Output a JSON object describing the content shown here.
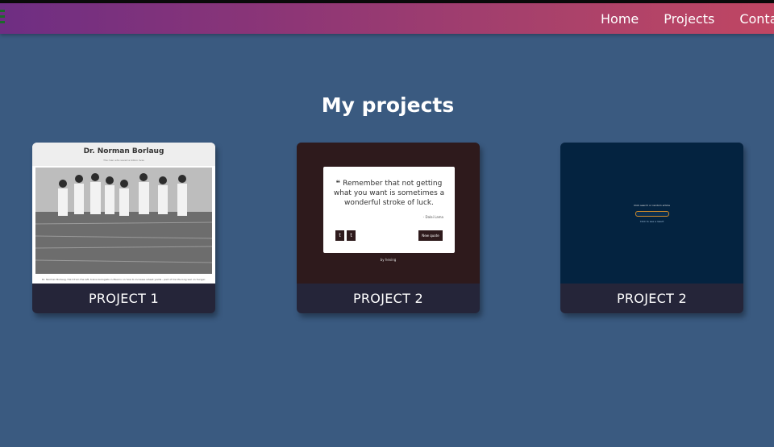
{
  "nav": {
    "links": [
      "Home",
      "Projects",
      "Contact"
    ]
  },
  "page": {
    "title": "My projects"
  },
  "projects": [
    {
      "label": "PROJECT 1",
      "thumb_title": "Dr. Norman Borlaug",
      "thumb_subtitle": "The man who saved a billion lives",
      "thumb_caption": "Dr. Norman Borlaug, third from the left, trains biologists in Mexico on how to increase wheat yields - part of his life-long war on hunger."
    },
    {
      "label": "PROJECT 2",
      "quote": "Remember that not getting what you want is sometimes a wonderful stroke of luck.",
      "quote_author": "- Dalai Lama",
      "twitter": "t",
      "tumblr": "t",
      "new_quote": "New quote",
      "by": "by hexing"
    },
    {
      "label": "PROJECT 2",
      "thumb_title": "Click search or random article",
      "thumb_link": "Click to see a result"
    }
  ],
  "colors": {
    "background": "#3a5a80",
    "nav_gradient_start": "#6e2e83",
    "nav_gradient_end": "#c04663",
    "card_label_bg": "#252539"
  }
}
